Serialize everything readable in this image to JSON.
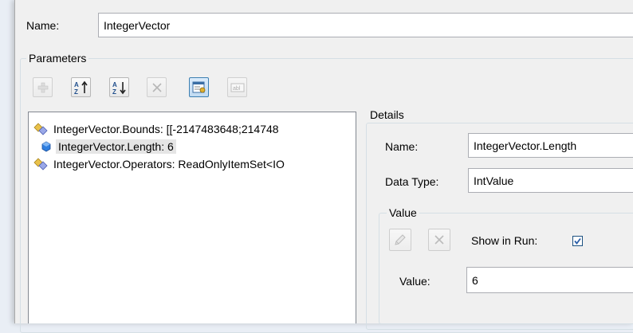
{
  "name_label": "Name:",
  "name_value": "IntegerVector",
  "parameters_title": "Parameters",
  "toolbar": {
    "add_icon": "plus-icon",
    "sort_asc_icon": "sort-az-ascending-icon",
    "sort_desc_icon": "sort-az-descending-icon",
    "remove_icon": "close-x-icon",
    "properties_icon": "properties-icon",
    "textbox_icon": "textbox-icon"
  },
  "tree_items": [
    {
      "label": "IntegerVector.Bounds: [[-2147483648;214748",
      "icon": "parameter-diamond-icon"
    },
    {
      "label": "IntegerVector.Length: 6",
      "icon": "value-parameter-icon"
    },
    {
      "label": "IntegerVector.Operators: ReadOnlyItemSet<IO",
      "icon": "parameter-diamond-icon"
    }
  ],
  "details": {
    "title": "Details",
    "name_label": "Name:",
    "name_value": "IntegerVector.Length",
    "datatype_label": "Data Type:",
    "datatype_value": "IntValue",
    "value_group_title": "Value",
    "show_in_run_label": "Show in Run:",
    "show_in_run_checked": true,
    "value_label": "Value:",
    "value_value": "6"
  },
  "colors": {
    "accent": "#3c7fb1",
    "selection": "#e5e5e5",
    "window": "#f0f0f0"
  }
}
